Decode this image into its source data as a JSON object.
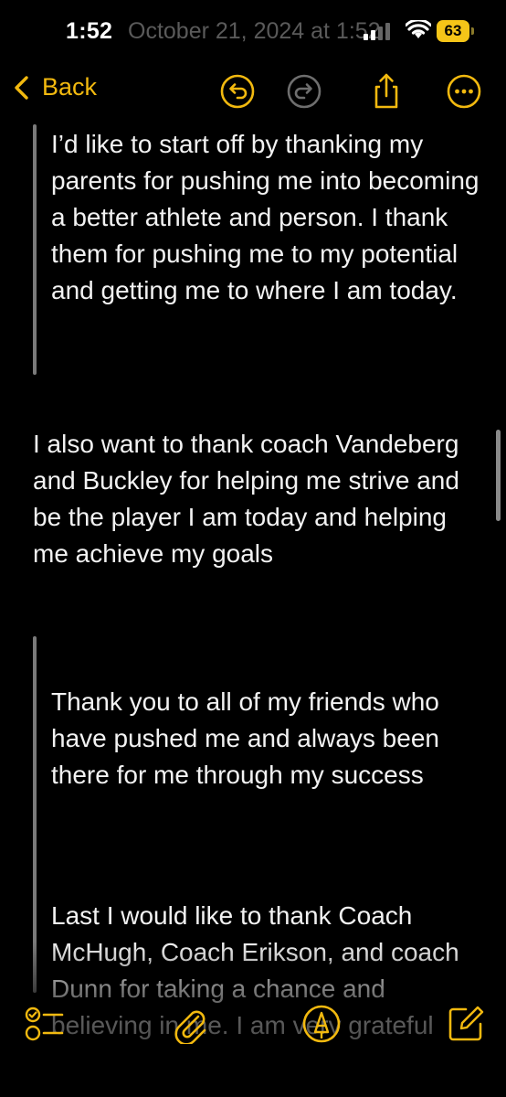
{
  "status": {
    "time": "1:52",
    "battery": "63",
    "overlay_date": "October 21, 2024 at 1:52"
  },
  "nav": {
    "back_label": "Back"
  },
  "icons": {
    "back": "chevron-left-icon",
    "undo": "undo-icon",
    "redo": "redo-icon",
    "share": "share-icon",
    "more": "more-icon",
    "checklist": "checklist-icon",
    "attach": "paperclip-icon",
    "markup": "pen-tip-icon",
    "compose": "compose-icon"
  },
  "colors": {
    "accent": "#f2b90f",
    "background": "#000000",
    "text": "#f2f2f2",
    "disabled": "#6e6e6e"
  },
  "note": {
    "paragraphs": [
      "I’d like to start off by thanking my parents for pushing me into becoming a better athlete and person. I thank them for pushing me to my potential and getting me to where I am today.",
      "I also want to thank coach Vandeberg and Buckley for helping me strive and be the player I am today and helping me achieve my goals",
      "Thank you to all of my friends who have pushed me and always been there for me through my success",
      "Last I would like to thank Coach McHugh, Coach Erikson, and coach Dunn for taking a chance and believing in me. I am very grateful"
    ]
  }
}
